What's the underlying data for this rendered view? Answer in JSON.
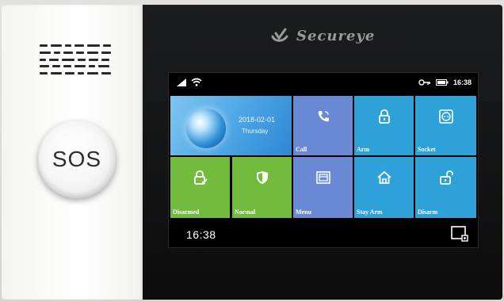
{
  "left_panel": {
    "sos_label": "SOS"
  },
  "brand": {
    "name": "Secureye"
  },
  "status_bar": {
    "time": "16:38"
  },
  "date_tile": {
    "date": "2018-02-01",
    "day": "Thursday"
  },
  "tiles": [
    {
      "label": "Call",
      "icon": "phone-icon",
      "color": "#6a89d4"
    },
    {
      "label": "Arm",
      "icon": "lock-closed-icon",
      "color": "#2ea1d8"
    },
    {
      "label": "Socket",
      "icon": "socket-icon",
      "color": "#2ea1d8"
    },
    {
      "label": "Disarmed",
      "icon": "lock-check-icon",
      "color": "#72bb3f"
    },
    {
      "label": "Normal",
      "icon": "shield-icon",
      "color": "#72bb3f"
    },
    {
      "label": "Menu",
      "icon": "menu-icon",
      "color": "#6a89d4"
    },
    {
      "label": "Stay Arm",
      "icon": "home-icon",
      "color": "#2ea1d8"
    },
    {
      "label": "Disarm",
      "icon": "lock-open-icon",
      "color": "#2ea1d8"
    }
  ],
  "bottom_bar": {
    "clock": "16:38",
    "button_icon": "screen-settings-icon"
  }
}
